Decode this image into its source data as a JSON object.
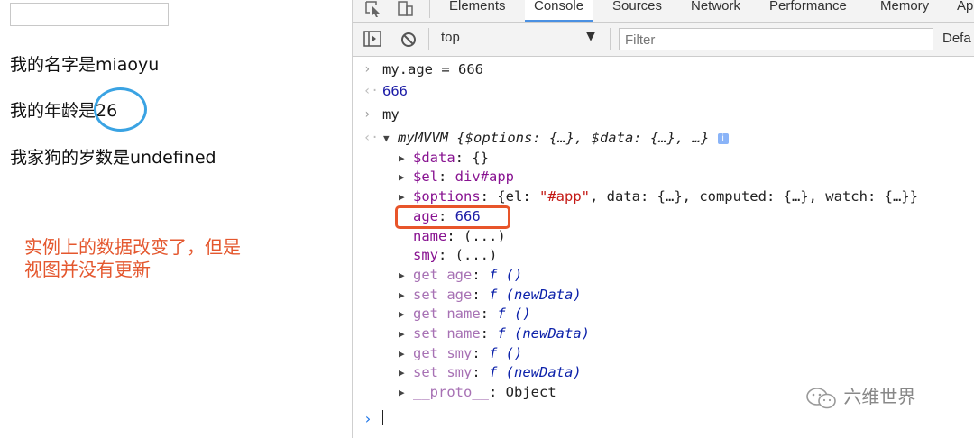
{
  "page": {
    "input_value": "",
    "name_line": "我的名字是miaoyu",
    "age_prefix": "我的年龄是",
    "age_value": "26",
    "dog_line": "我家狗的岁数是undefined",
    "note_line1": "实例上的数据改变了，但是",
    "note_line2": "视图并没有更新"
  },
  "devtools": {
    "tabs": [
      "Elements",
      "Console",
      "Sources",
      "Network",
      "Performance",
      "Memory",
      "Ap"
    ],
    "active_tab": "Console",
    "toolbar": {
      "context": "top",
      "filter_placeholder": "Filter",
      "levels": "Defa"
    },
    "console": {
      "cmd1": "my.age = 666",
      "res1": "666",
      "cmd2": "my",
      "obj_name": "myMVVM",
      "obj_preview": " {$options: {…}, $data: {…}, …}",
      "props": {
        "data_key": "$data",
        "data_val": "{}",
        "el_key": "$el",
        "el_val": "div#app",
        "options_key": "$options",
        "options_pre": "{el: ",
        "options_str": "\"#app\"",
        "options_post": ", data: {…}, computed: {…}, watch: {…}}",
        "age_key": "age",
        "age_val": "666",
        "name_key": "name",
        "name_val": "(...)",
        "smy_key": "smy",
        "smy_val": "(...)"
      },
      "accessors": [
        {
          "kind": "get",
          "prop": "age",
          "sig": "f ()"
        },
        {
          "kind": "set",
          "prop": "age",
          "sig": "f (newData)"
        },
        {
          "kind": "get",
          "prop": "name",
          "sig": "f ()"
        },
        {
          "kind": "set",
          "prop": "name",
          "sig": "f (newData)"
        },
        {
          "kind": "get",
          "prop": "smy",
          "sig": "f ()"
        },
        {
          "kind": "set",
          "prop": "smy",
          "sig": "f (newData)"
        }
      ],
      "proto_key": "__proto__",
      "proto_val": "Object"
    }
  },
  "watermark": "六维世界",
  "colors": {
    "annotation": "#e4572e",
    "circle": "#3aa3e3",
    "highlight_box": "#e8552a",
    "active_tab_underline": "#4a90e2"
  }
}
